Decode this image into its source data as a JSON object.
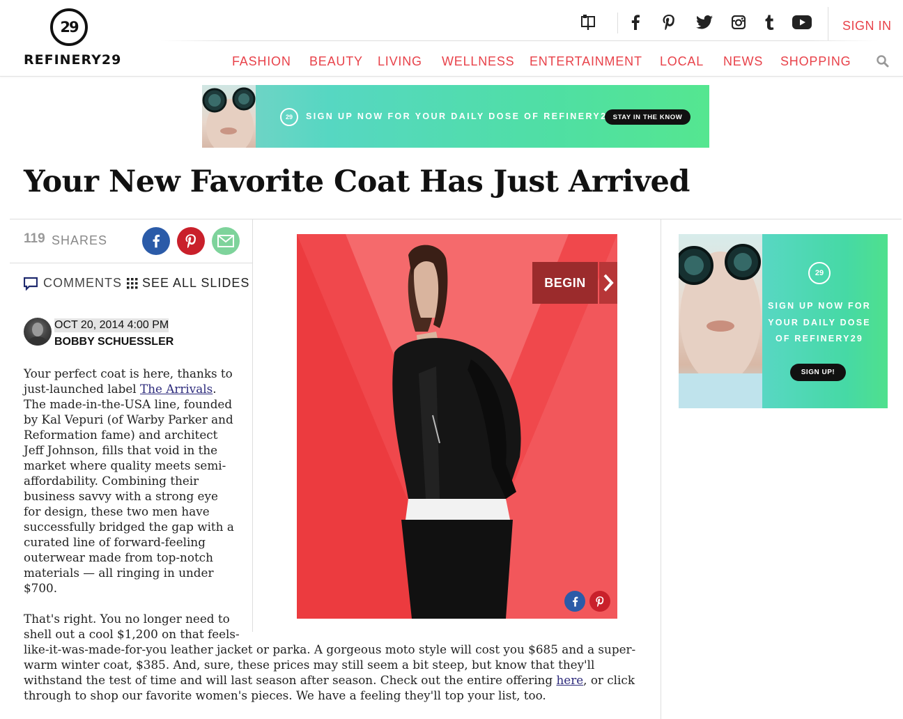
{
  "brand": {
    "logo_mark": "29",
    "name": "REFINERY29"
  },
  "header": {
    "social_icons": [
      "newsletter-icon",
      "facebook-icon",
      "pinterest-icon",
      "twitter-icon",
      "instagram-icon",
      "tumblr-icon",
      "youtube-icon"
    ],
    "sign_in": "SIGN IN"
  },
  "nav": {
    "items": [
      {
        "label": "FASHION"
      },
      {
        "label": "BEAUTY"
      },
      {
        "label": "LIVING"
      },
      {
        "label": "WELLNESS"
      },
      {
        "label": "ENTERTAINMENT"
      },
      {
        "label": "LOCAL"
      },
      {
        "label": "NEWS"
      },
      {
        "label": "SHOPPING"
      }
    ]
  },
  "top_banner": {
    "logo": "29",
    "text": "SIGN UP NOW FOR YOUR DAILY DOSE OF REFINERY29",
    "button": "STAY IN THE KNOW"
  },
  "article": {
    "title": "Your New Favorite Coat Has Just Arrived",
    "shares": {
      "count": "119",
      "label": "SHARES"
    },
    "comments_label": "COMMENTS",
    "see_all_label": "SEE ALL SLIDES",
    "date": "OCT 20, 2014 4:00 PM",
    "author": "BOBBY SCHUESSLER",
    "p1": {
      "before_link": "Your perfect coat is here, thanks to just-launched label ",
      "link": "The Arrivals",
      "after_link": ". The made-in-the-USA line, founded by Kal Vepuri (of Warby Parker and Reformation fame) and architect Jeff Johnson, fills that void in the market where quality meets semi-affordability. Combining their business savvy with a strong eye for design, these two men have successfully bridged the gap with a curated line of forward-feeling outerwear made from top-notch materials — all ringing in under $700."
    },
    "p2": {
      "line1": "That's right. You no longer need to",
      "line2": "shell out a cool $1,200 on that feels-",
      "rest_before_link": "like-it-was-made-for-you leather jacket or parka. A gorgeous moto style will cost you $685 and a super-warm winter coat, $385. And, sure, these prices may still seem a bit steep, but know that they'll withstand the test of time and will last season after season. Check out the entire offering ",
      "link": "here",
      "after_link": ", or click through to shop our favorite women's pieces. We have a feeling they'll top your list, too."
    }
  },
  "slideshow": {
    "begin_label": "BEGIN",
    "share_icons": [
      "facebook-icon",
      "pinterest-icon"
    ]
  },
  "side_ad": {
    "logo": "29",
    "text": "SIGN UP NOW FOR YOUR DAILY DOSE OF REFINERY29",
    "button": "SIGN UP!"
  },
  "colors": {
    "accent": "#e8424a",
    "facebook": "#2b5ba8",
    "pinterest": "#c9202b",
    "email": "#7ed39b",
    "slide_bg": "#f0484c"
  }
}
